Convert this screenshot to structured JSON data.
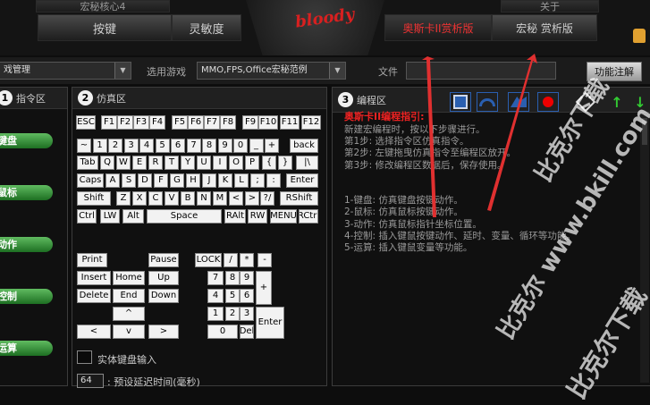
{
  "nav": {
    "top_left": "宏秘核心4",
    "top_right": "关于",
    "tab_keys": "按键",
    "tab_sens": "灵敏度",
    "logo": "bloody",
    "tab_oscar": "奥斯卡II赏析版",
    "tab_macro": "宏秘 赏析版"
  },
  "toolbar": {
    "game_mgmt": "戏管理",
    "select_label": "选用游戏",
    "select_value": "MMO,FPS,Office宏秘范例",
    "file_label": "文件",
    "file_value": "",
    "func_button": "功能注解"
  },
  "panel1": {
    "num": "1",
    "title": "指令区",
    "items": [
      "键盘",
      "鼠标",
      "动作",
      "控制",
      "运算"
    ]
  },
  "panel2": {
    "num": "2",
    "title": "仿真区",
    "kb_input": "实体键盘输入",
    "delay_value": "64",
    "delay_label": ": 预设延迟时间(毫秒)"
  },
  "panel3": {
    "num": "3",
    "title": "编程区",
    "editor_title": "奥斯卡II编程指引:",
    "editor_text": "新建宏编程时，按以下步骤进行。\n第1步: 选择指令区仿真指令。\n第2步: 左键拖曳仿真指令至编程区放开。\n第3步: 修改编程区数据后，保存使用。\n\n\n1-键盘: 仿真键盘按键动作。\n2-鼠标: 仿真鼠标按键动作。\n3-动作: 仿真鼠标指针坐标位置。\n4-控制: 插入键鼠按键动作、延时、变量、循环等功能。\n5-运算: 插入键鼠变量等功能。"
  },
  "watermark": {
    "l1": "比克尔下载",
    "l2": "比克尔 www.bkill.com",
    "l3": "比克尔下载"
  },
  "colors": {
    "accent_red": "#e22222",
    "green_button": "#2e8b34",
    "toolbar_blue": "#2a5fb0"
  }
}
